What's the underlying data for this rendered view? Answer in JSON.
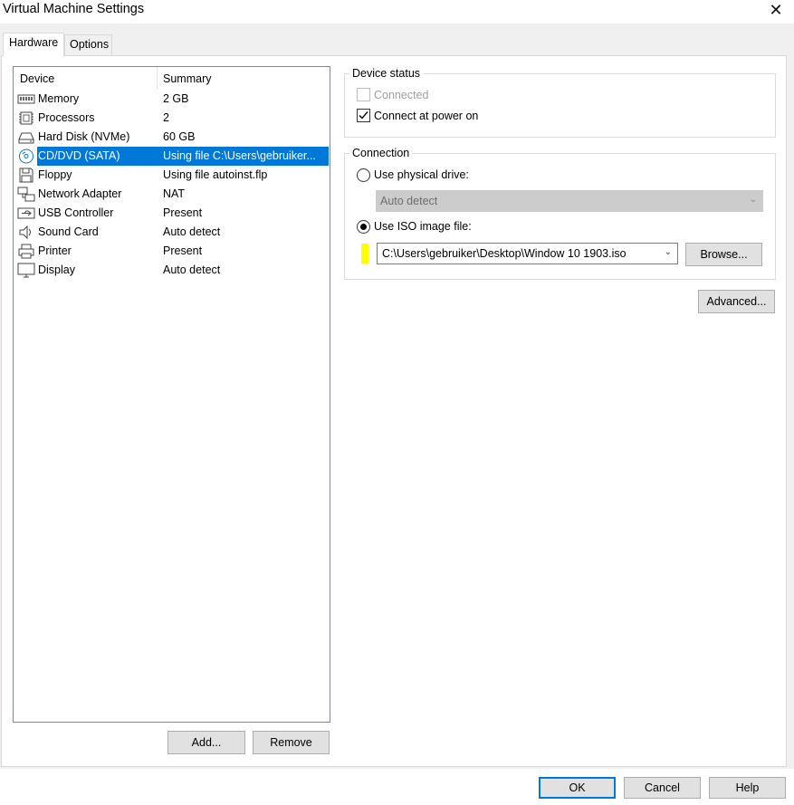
{
  "window": {
    "title": "Virtual Machine Settings",
    "close": "✕"
  },
  "tabs": [
    {
      "label": "Hardware",
      "active": true
    },
    {
      "label": "Options",
      "active": false
    }
  ],
  "device_list": {
    "columns": [
      "Device",
      "Summary"
    ],
    "rows": [
      {
        "name": "Memory",
        "summary": "2 GB",
        "icon": "memory-icon"
      },
      {
        "name": "Processors",
        "summary": "2",
        "icon": "processor-icon"
      },
      {
        "name": "Hard Disk (NVMe)",
        "summary": "60 GB",
        "icon": "hard-disk-icon"
      },
      {
        "name": "CD/DVD (SATA)",
        "summary": "Using file C:\\Users\\gebruiker...",
        "icon": "cd-dvd-icon",
        "selected": true
      },
      {
        "name": "Floppy",
        "summary": "Using file autoinst.flp",
        "icon": "floppy-icon"
      },
      {
        "name": "Network Adapter",
        "summary": "NAT",
        "icon": "network-adapter-icon"
      },
      {
        "name": "USB Controller",
        "summary": "Present",
        "icon": "usb-icon"
      },
      {
        "name": "Sound Card",
        "summary": "Auto detect",
        "icon": "speaker-icon"
      },
      {
        "name": "Printer",
        "summary": "Present",
        "icon": "printer-icon"
      },
      {
        "name": "Display",
        "summary": "Auto detect",
        "icon": "display-icon"
      }
    ]
  },
  "list_buttons": {
    "add": "Add...",
    "remove": "Remove"
  },
  "device_status": {
    "label": "Device status",
    "connected": {
      "label": "Connected",
      "checked": false,
      "disabled": true
    },
    "connect_at_power_on": {
      "label": "Connect at power on",
      "checked": true
    }
  },
  "connection": {
    "label": "Connection",
    "physical": {
      "label": "Use physical drive:",
      "selected": false
    },
    "physical_drive_value": "Auto detect",
    "iso": {
      "label": "Use ISO image file:",
      "selected": true
    },
    "iso_path": "C:\\Users\\gebruiker\\Desktop\\Window 10 1903.iso",
    "browse": "Browse..."
  },
  "advanced": "Advanced...",
  "footer": {
    "ok": "OK",
    "cancel": "Cancel",
    "help": "Help"
  },
  "colors": {
    "selection": "#0078d7",
    "highlight_marker": "#ffff00",
    "ok_border": "#0078d7"
  }
}
